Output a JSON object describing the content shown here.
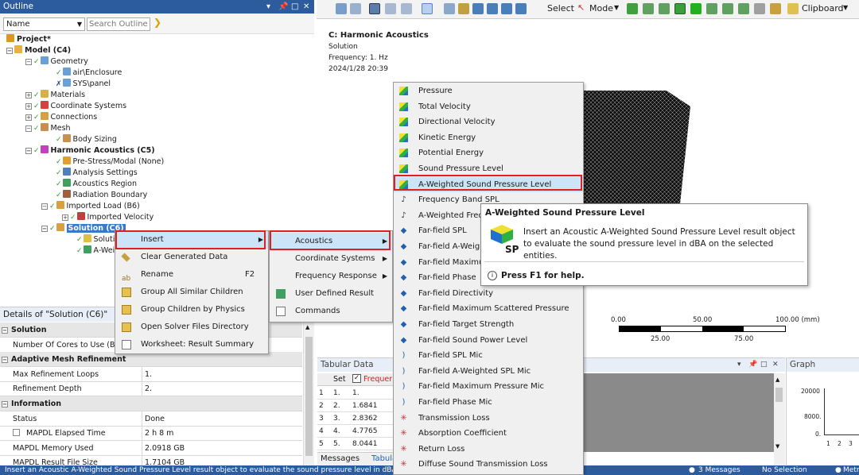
{
  "outline": {
    "title": "Outline",
    "name_col": "Name",
    "search_placeholder": "Search Outline",
    "tree": [
      {
        "label": "Project*"
      },
      {
        "label": "Model (C4)"
      },
      {
        "label": "Geometry"
      },
      {
        "label": "air\\Enclosure"
      },
      {
        "label": "SYS\\panel"
      },
      {
        "label": "Materials"
      },
      {
        "label": "Coordinate Systems"
      },
      {
        "label": "Connections"
      },
      {
        "label": "Mesh"
      },
      {
        "label": "Body Sizing"
      },
      {
        "label": "Harmonic Acoustics (C5)"
      },
      {
        "label": "Pre-Stress/Modal (None)"
      },
      {
        "label": "Analysis Settings"
      },
      {
        "label": "Acoustics Region"
      },
      {
        "label": "Radiation Boundary"
      },
      {
        "label": "Imported Load (B6)"
      },
      {
        "label": "Imported Velocity"
      },
      {
        "label": "Solution (C6)"
      },
      {
        "label": "Solution Information"
      },
      {
        "label": "A-Weighted Sound Pressure Level"
      }
    ]
  },
  "context_menu": {
    "items": [
      {
        "label": "Insert",
        "shortcut": ""
      },
      {
        "label": "Clear Generated Data",
        "shortcut": ""
      },
      {
        "label": "Rename",
        "shortcut": "F2"
      },
      {
        "label": "Group All Similar Children",
        "shortcut": ""
      },
      {
        "label": "Group Children by Physics",
        "shortcut": ""
      },
      {
        "label": "Open Solver Files Directory",
        "shortcut": ""
      },
      {
        "label": "Worksheet: Result Summary",
        "shortcut": ""
      }
    ]
  },
  "insert_submenu": {
    "items": [
      {
        "label": "Acoustics"
      },
      {
        "label": "Coordinate Systems"
      },
      {
        "label": "Frequency Response"
      },
      {
        "label": "User Defined Result"
      },
      {
        "label": "Commands"
      }
    ]
  },
  "acoustics_submenu": {
    "items": [
      {
        "label": "Pressure"
      },
      {
        "label": "Total Velocity"
      },
      {
        "label": "Directional Velocity"
      },
      {
        "label": "Kinetic Energy"
      },
      {
        "label": "Potential Energy"
      },
      {
        "label": "Sound Pressure Level"
      },
      {
        "label": "A-Weighted Sound Pressure Level"
      },
      {
        "label": "Frequency Band SPL"
      },
      {
        "label": "A-Weighted Frequency Band SPL"
      },
      {
        "label": "Far-field SPL"
      },
      {
        "label": "Far-field A-Weighted SPL"
      },
      {
        "label": "Far-field Maximum Pressure"
      },
      {
        "label": "Far-field Phase"
      },
      {
        "label": "Far-field Directivity"
      },
      {
        "label": "Far-field Maximum Scattered Pressure"
      },
      {
        "label": "Far-field Target Strength"
      },
      {
        "label": "Far-field Sound Power Level"
      },
      {
        "label": "Far-field SPL Mic"
      },
      {
        "label": "Far-field A-Weighted SPL Mic"
      },
      {
        "label": "Far-field Maximum Pressure Mic"
      },
      {
        "label": "Far-field Phase Mic"
      },
      {
        "label": "Transmission Loss"
      },
      {
        "label": "Absorption Coefficient"
      },
      {
        "label": "Return Loss"
      },
      {
        "label": "Diffuse Sound Transmission Loss"
      }
    ]
  },
  "tooltip": {
    "title": "A-Weighted Sound Pressure Level",
    "body": "Insert an Acoustic A-Weighted Sound Pressure Level result object to evaluate the sound pressure level in dBA on the selected entities.",
    "icon_label": "SP",
    "help": "Press F1 for help."
  },
  "toolbar": {
    "select": "Select",
    "mode": "Mode",
    "clipboard": "Clipboard"
  },
  "viewport": {
    "title": "C: Harmonic Acoustics",
    "subtitle": "Solution",
    "frequency": "Frequency: 1. Hz",
    "date": "2024/1/28 20:39",
    "scale": {
      "t0": "0.00",
      "t1": "50.00",
      "t2": "100.00 (mm)",
      "b1": "25.00",
      "b2": "75.00"
    }
  },
  "details": {
    "title": "Details of \"Solution (C6)\"",
    "rows": [
      {
        "type": "section",
        "label": "Solution",
        "value": ""
      },
      {
        "type": "row",
        "label": "Number Of Cores to Use (Beta)",
        "value": ""
      },
      {
        "type": "section",
        "label": "Adaptive Mesh Refinement",
        "value": ""
      },
      {
        "type": "row",
        "label": "Max Refinement Loops",
        "value": "1."
      },
      {
        "type": "row",
        "label": "Refinement Depth",
        "value": "2."
      },
      {
        "type": "section",
        "label": "Information",
        "value": ""
      },
      {
        "type": "row",
        "label": "Status",
        "value": "Done"
      },
      {
        "type": "check",
        "label": "MAPDL Elapsed Time",
        "value": "2 h 8 m"
      },
      {
        "type": "row",
        "label": "MAPDL Memory Used",
        "value": "2.0918 GB"
      },
      {
        "type": "row",
        "label": "MAPDL Result File Size",
        "value": "1.7104 GB"
      }
    ]
  },
  "tabular": {
    "title": "Tabular Data",
    "col_set": "Set",
    "col_freq": "Frequency",
    "rows": [
      {
        "i": "1",
        "set": "1.",
        "f": "1."
      },
      {
        "i": "2",
        "set": "2.",
        "f": "1.6841"
      },
      {
        "i": "3",
        "set": "3.",
        "f": "2.8362"
      },
      {
        "i": "4",
        "set": "4.",
        "f": "4.7765"
      },
      {
        "i": "5",
        "set": "5.",
        "f": "8.0441"
      }
    ],
    "tabs": [
      "Messages",
      "Tabular Data"
    ]
  },
  "graph": {
    "title": "Graph",
    "y1": "20000",
    "y2": "8000.",
    "y3": "0.",
    "x": [
      "1",
      "2",
      "3"
    ]
  },
  "status_bar": {
    "text": "Insert an Acoustic A-Weighted Sound Pressure Level result object to evaluate the sound pressure level in dBA on the selected entities.",
    "messages": "3 Messages",
    "selection": "No Selection",
    "metric": "Metric"
  }
}
